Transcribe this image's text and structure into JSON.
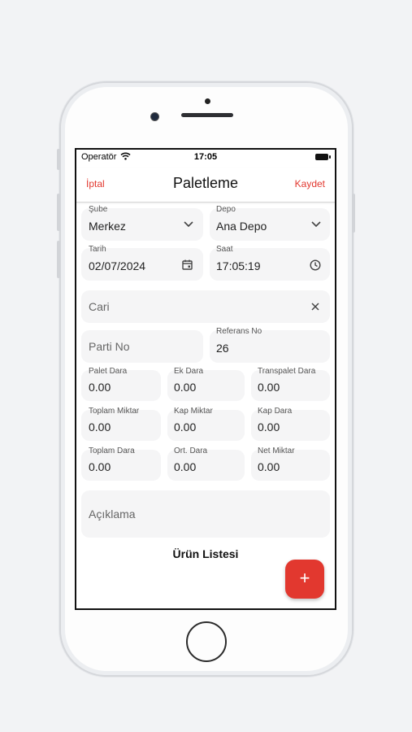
{
  "status": {
    "carrier": "Operatör",
    "time": "17:05"
  },
  "nav": {
    "cancel": "İptal",
    "title": "Paletleme",
    "save": "Kaydet"
  },
  "form": {
    "sube": {
      "label": "Şube",
      "value": "Merkez"
    },
    "depo": {
      "label": "Depo",
      "value": "Ana Depo"
    },
    "tarih": {
      "label": "Tarih",
      "value": "02/07/2024"
    },
    "saat": {
      "label": "Saat",
      "value": "17:05:19"
    },
    "cari": {
      "placeholder": "Cari"
    },
    "parti_no": {
      "placeholder": "Parti No"
    },
    "referans_no": {
      "label": "Referans No",
      "value": "26"
    },
    "palet_dara": {
      "label": "Palet Dara",
      "value": "0.00"
    },
    "ek_dara": {
      "label": "Ek Dara",
      "value": "0.00"
    },
    "transpalet_dara": {
      "label": "Transpalet Dara",
      "value": "0.00"
    },
    "toplam_miktar": {
      "label": "Toplam Miktar",
      "value": "0.00"
    },
    "kap_miktar": {
      "label": "Kap Miktar",
      "value": "0.00"
    },
    "kap_dara": {
      "label": "Kap Dara",
      "value": "0.00"
    },
    "toplam_dara": {
      "label": "Toplam Dara",
      "value": "0.00"
    },
    "ort_dara": {
      "label": "Ort. Dara",
      "value": "0.00"
    },
    "net_miktar": {
      "label": "Net Miktar",
      "value": "0.00"
    },
    "aciklama": {
      "placeholder": "Açıklama"
    }
  },
  "list": {
    "title": "Ürün Listesi"
  },
  "fab": {
    "icon": "+"
  },
  "colors": {
    "accent": "#e2382f",
    "field_bg": "#f5f5f6"
  },
  "icons": {
    "chevron": "chevron-down-icon",
    "calendar": "calendar-icon",
    "clock": "clock-icon",
    "clear": "close-icon",
    "wifi": "wifi-icon",
    "battery": "battery-icon"
  }
}
